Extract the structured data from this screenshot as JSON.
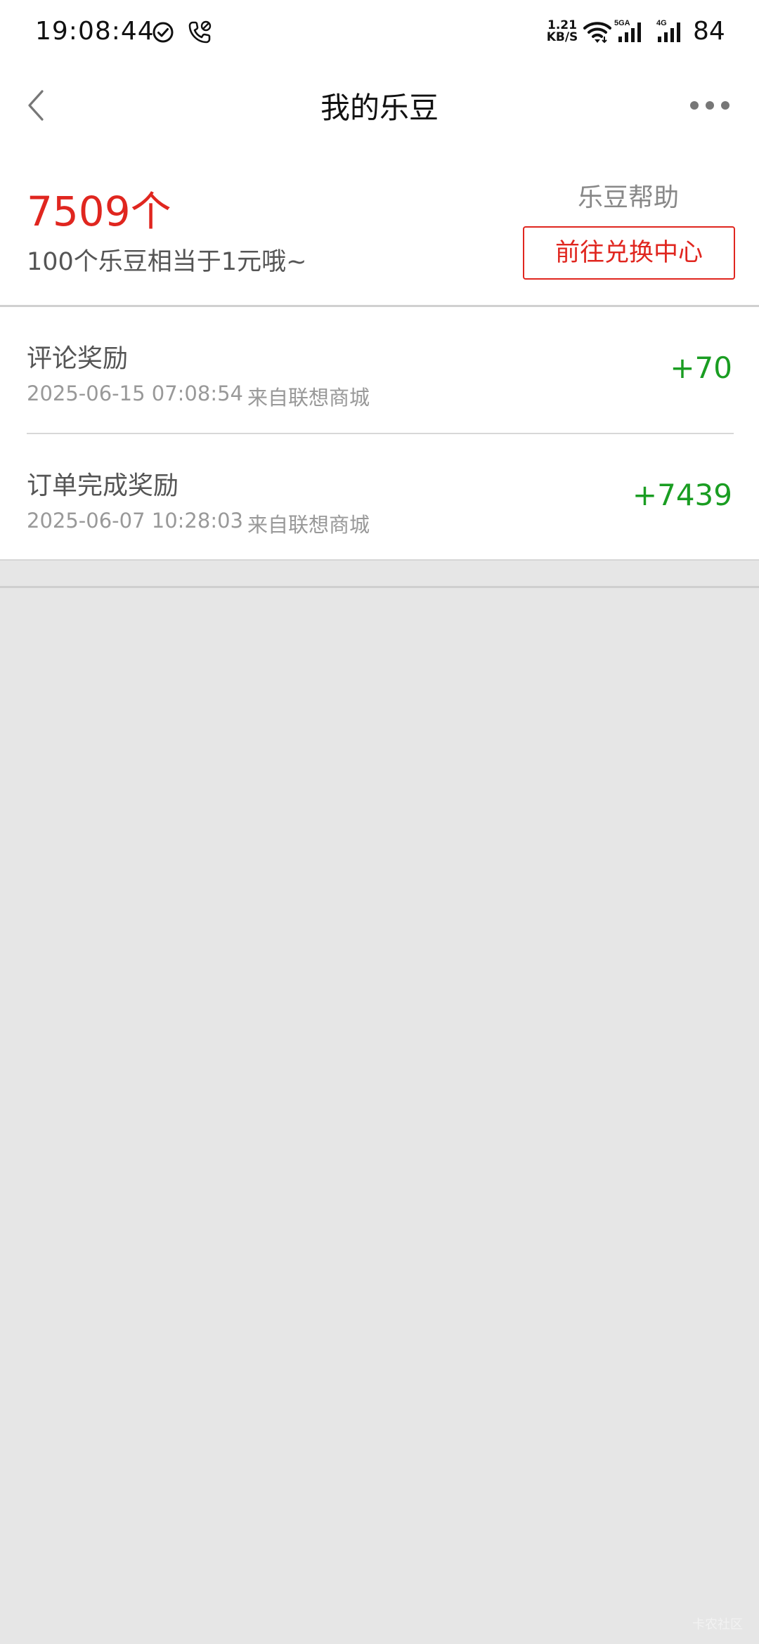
{
  "status_bar": {
    "time": "19:08:44",
    "net_speed_value": "1.21",
    "net_speed_unit": "KB/S",
    "signal1_label": "5GA",
    "signal2_label": "4G",
    "battery": "84",
    "icons": [
      "check-circle-icon",
      "phone-call-icon",
      "wifi-icon",
      "signal-5ga-icon",
      "signal-4g-icon"
    ]
  },
  "nav": {
    "title": "我的乐豆",
    "icons": [
      "chevron-left-icon",
      "more-dots-icon"
    ]
  },
  "summary": {
    "count": "7509个",
    "hint": "100个乐豆相当于1元哦~",
    "help_label": "乐豆帮助",
    "exchange_label": "前往兑换中心"
  },
  "records": [
    {
      "title": "评论奖励",
      "time": "2025-06-15 07:08:54",
      "source": "来自联想商城",
      "amount": "+70"
    },
    {
      "title": "订单完成奖励",
      "time": "2025-06-07 10:28:03",
      "source": "来自联想商城",
      "amount": "+7439"
    }
  ],
  "colors": {
    "accent_red": "#e0261f",
    "positive_green": "#1a9d22",
    "background_gray": "#e6e6e6"
  },
  "watermark": "卡农社区"
}
